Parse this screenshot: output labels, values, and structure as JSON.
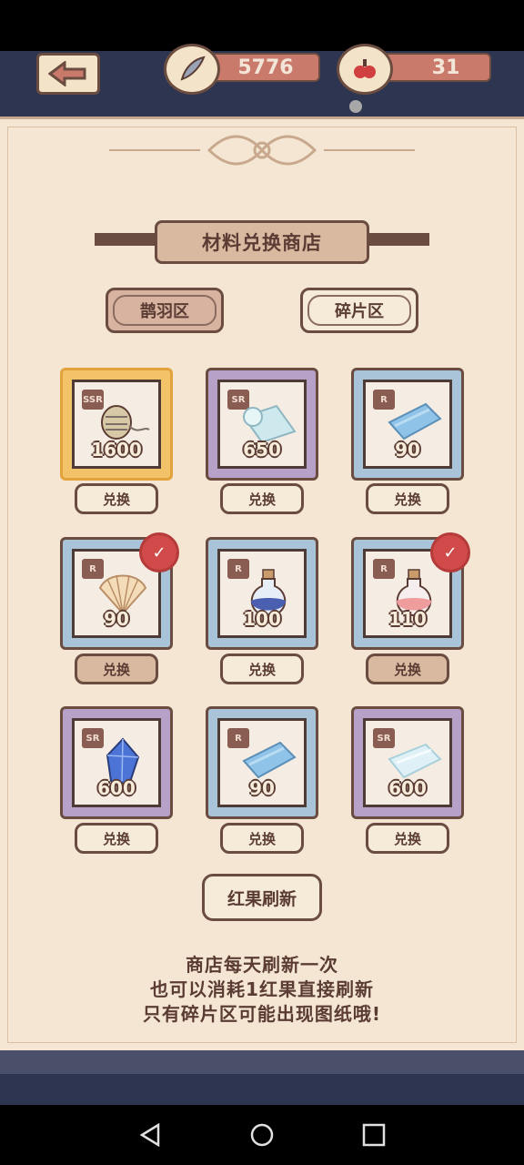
{
  "header": {
    "feather_count": "5776",
    "berry_count": "31"
  },
  "title": "材料兑换商店",
  "zones": {
    "feather_zone": "鹊羽区",
    "fragment_zone": "碎片区"
  },
  "items": [
    {
      "rarity": "SSR",
      "price": "1600",
      "icon": "thread-spool-icon",
      "redeem": "兑换",
      "redeem_enabled": true
    },
    {
      "rarity": "SR",
      "price": "650",
      "icon": "silk-roll-icon",
      "redeem": "兑换",
      "redeem_enabled": true
    },
    {
      "rarity": "R",
      "price": "90",
      "icon": "cloth-blue-icon",
      "redeem": "兑换",
      "redeem_enabled": true
    },
    {
      "rarity": "R",
      "price": "90",
      "icon": "seashell-icon",
      "redeem": "兑换",
      "redeem_enabled": false,
      "sold_out": true
    },
    {
      "rarity": "R",
      "price": "100",
      "icon": "blue-potion-icon",
      "redeem": "兑换",
      "redeem_enabled": true
    },
    {
      "rarity": "R",
      "price": "110",
      "icon": "pink-potion-icon",
      "redeem": "兑换",
      "redeem_enabled": false,
      "sold_out": true
    },
    {
      "rarity": "SR",
      "price": "600",
      "icon": "crystal-icon",
      "redeem": "兑换",
      "redeem_enabled": true
    },
    {
      "rarity": "R",
      "price": "90",
      "icon": "cloth-blue-icon",
      "redeem": "兑换",
      "redeem_enabled": true
    },
    {
      "rarity": "SR",
      "price": "600",
      "icon": "ice-cloth-icon",
      "redeem": "兑换",
      "redeem_enabled": true
    }
  ],
  "refresh_button": "红果刷新",
  "notice": {
    "line1": "商店每天刷新一次",
    "line2": "也可以消耗1红果直接刷新",
    "line3": "只有碎片区可能出现图纸哦!"
  },
  "colors": {
    "panel": "#f4e6d2",
    "border": "#6b4c40",
    "rarity_R": "#a9c4d9",
    "rarity_SR": "#b7a1c9",
    "rarity_SSR": "#f3c36a"
  }
}
